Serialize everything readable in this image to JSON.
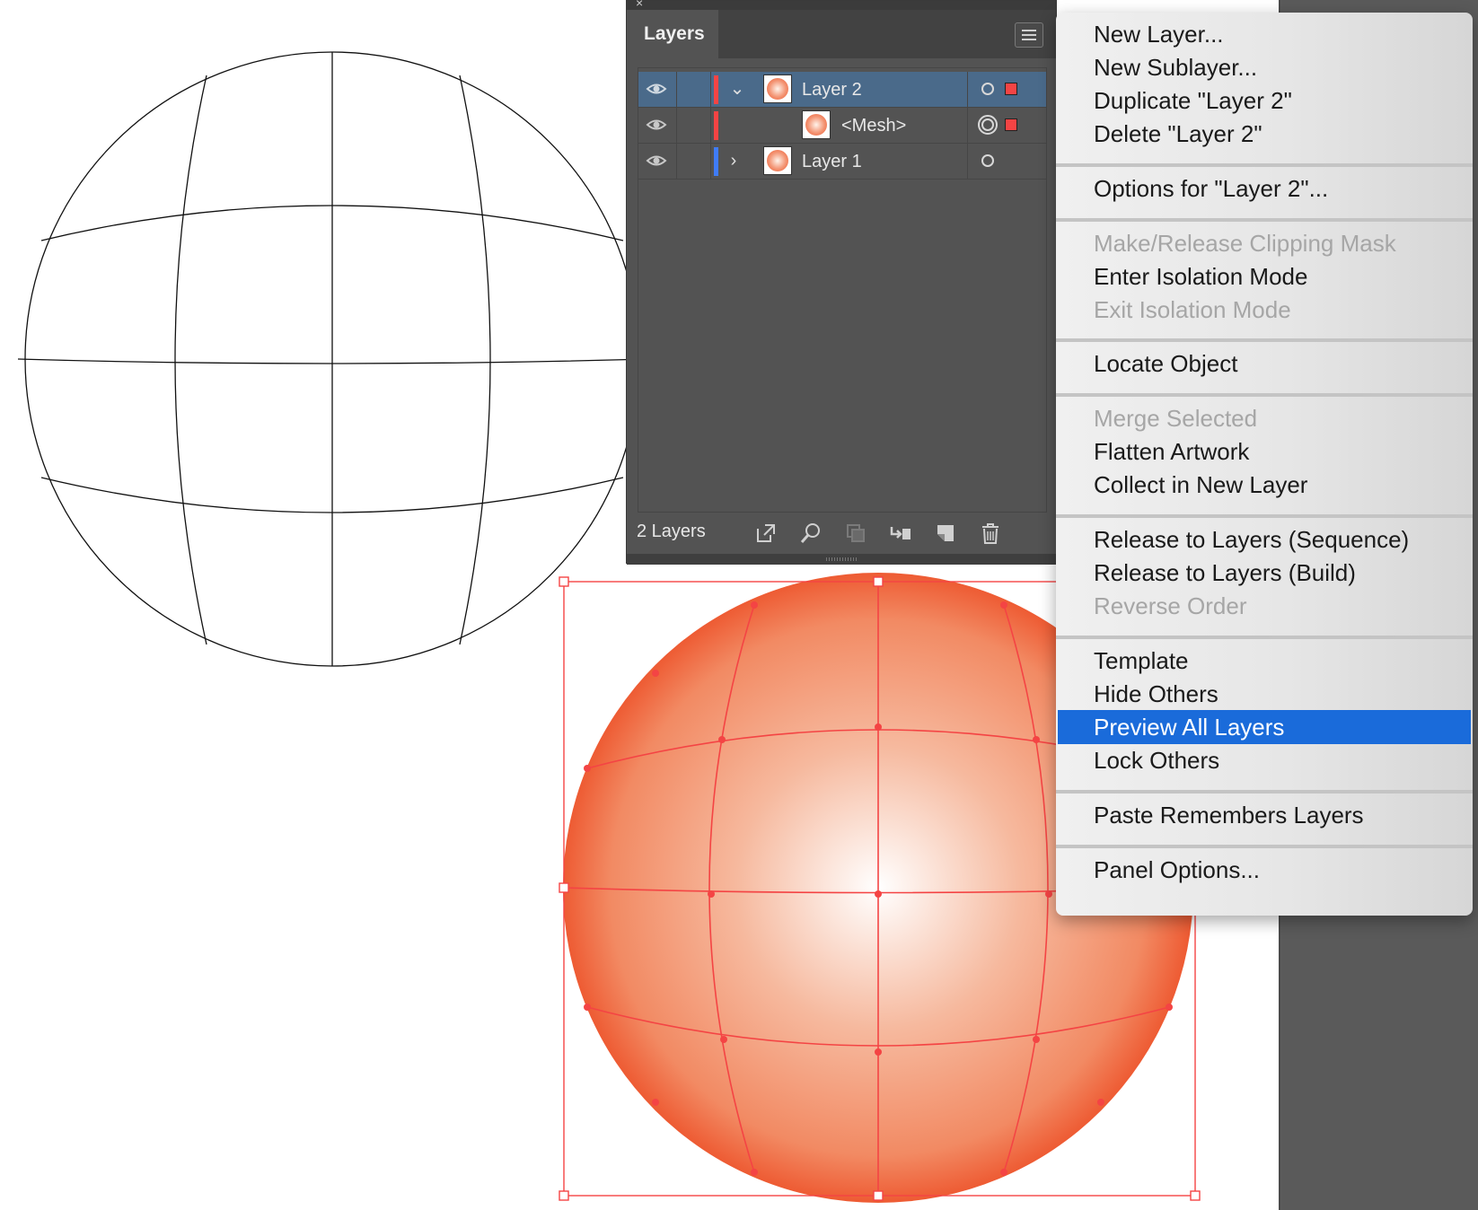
{
  "layers_panel": {
    "tab_label": "Layers",
    "close_glyph": "×",
    "layers_count": "2 Layers",
    "rows": [
      {
        "name": "Layer 2",
        "color": "#f44444",
        "twirl": "⌄",
        "selected": true
      },
      {
        "name": "<Mesh>",
        "color": "#f44444",
        "twirl": "",
        "selected": false
      },
      {
        "name": "Layer 1",
        "color": "#3f7cf7",
        "twirl": "›",
        "selected": false
      }
    ],
    "footer_icons": [
      "export-icon",
      "locate-icon",
      "clipping-mask-icon",
      "new-sublayer-icon",
      "new-layer-icon",
      "trash-icon"
    ]
  },
  "context_menu": {
    "items": [
      "New Layer...",
      "New Sublayer...",
      "Duplicate \"Layer 2\"",
      "Delete \"Layer 2\"",
      "Options for \"Layer 2\"...",
      "Make/Release Clipping Mask",
      "Enter Isolation Mode",
      "Exit Isolation Mode",
      "Locate Object",
      "Merge Selected",
      "Flatten Artwork",
      "Collect in New Layer",
      "Release to Layers (Sequence)",
      "Release to Layers (Build)",
      "Reverse Order",
      "Template",
      "Hide Others",
      "Preview All Layers",
      "Lock Others",
      "Paste Remembers Layers",
      "Panel Options..."
    ],
    "highlighted": "Preview All Layers",
    "disabled": [
      "Make/Release Clipping Mask",
      "Exit Isolation Mode",
      "Merge Selected",
      "Reverse Order"
    ]
  },
  "colors": {
    "selection": "#f44444",
    "highlight": "#1a6bda",
    "sphere_edge": "#ee5b33",
    "sphere_center": "#ffffff"
  }
}
